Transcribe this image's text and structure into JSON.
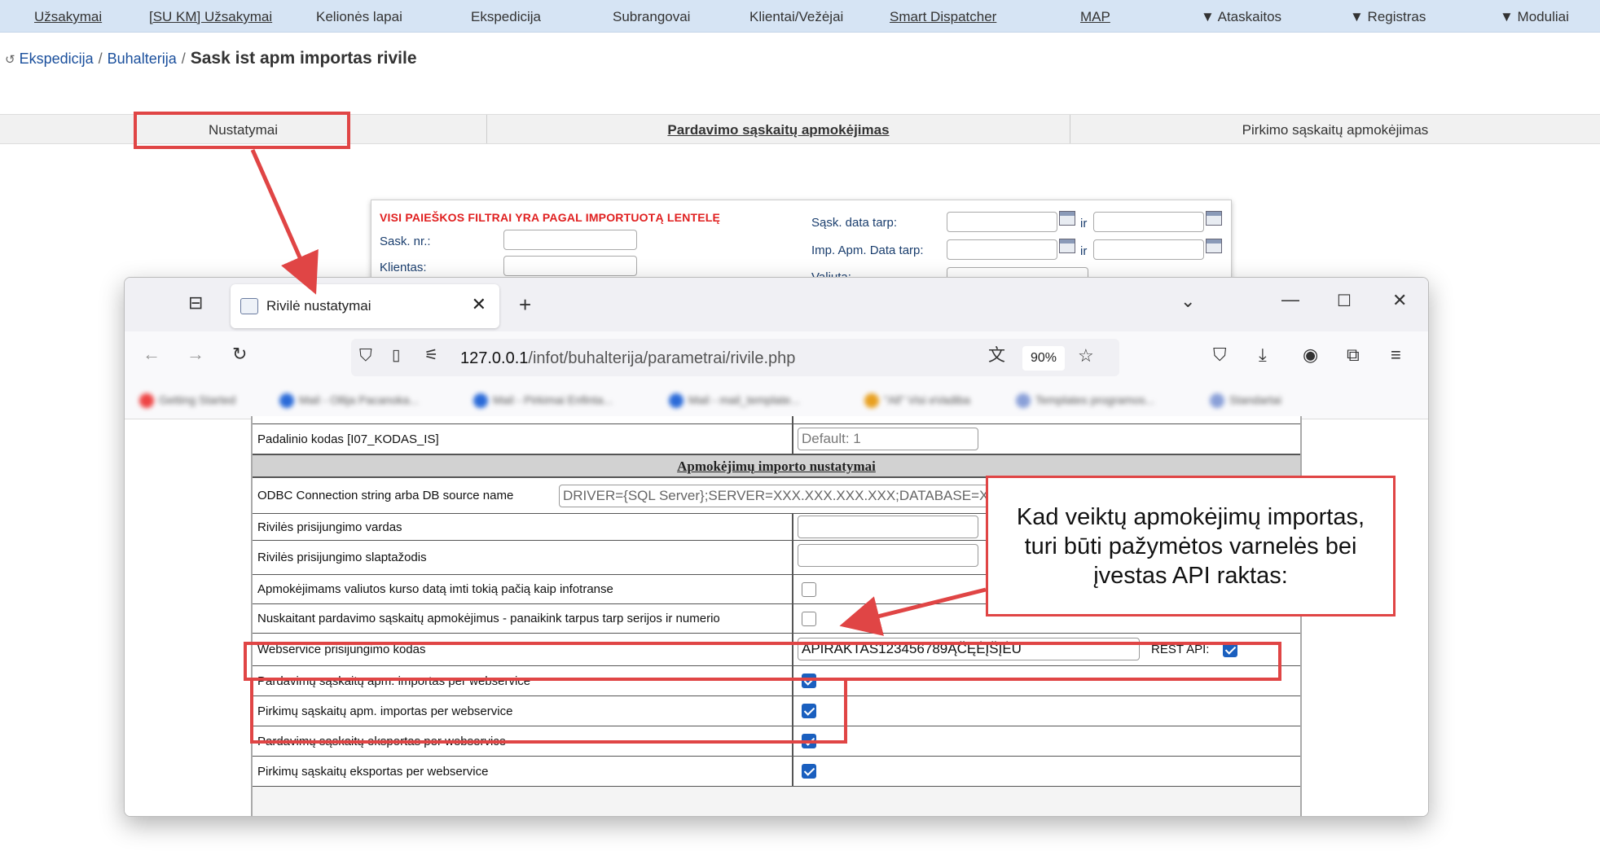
{
  "topnav": {
    "items": [
      "Užsakymai",
      "[SU KM] Užsakymai",
      "Kelionės lapai",
      "Ekspedicija",
      "Subrangovai",
      "Klientai/Vežėjai",
      "Smart Dispatcher",
      "MAP",
      "▼ Ataskaitos",
      "▼ Registras",
      "▼ Moduliai"
    ]
  },
  "breadcrumb": {
    "link1": "Ekspedicija",
    "link2": "Buhalterija",
    "sep": "/",
    "current": "Sask ist apm importas rivile"
  },
  "tabs": {
    "settings": "Nustatymai",
    "sales": "Pardavimo sąskaitų apmokėjimas",
    "purchase": "Pirkimo sąskaitų apmokėjimas"
  },
  "filter": {
    "warning": "VISI PAIEŠKOS FILTRAI YRA PAGAL IMPORTUOTĄ LENTELĘ",
    "invoice_no": "Sask. nr.:",
    "client": "Klientas:",
    "invoice_date": "Sąsk. data tarp:",
    "payment_date": "Imp. Apm. Data tarp:",
    "currency": "Valiuta:",
    "and": "ir"
  },
  "browser": {
    "tab_title": "Rivilė nustatymai",
    "url_host": "127.0.0.1",
    "url_path": "/infot/buhalterija/parametrai/rivile.php",
    "zoom": "90%",
    "bookmarks": [
      "Getting Started",
      "Mail - Ollija Pacanoka...",
      "Mail - Pirkimai Enfinta...",
      "Mail - mail_template...",
      "\"All\" Visi eVadiba",
      "Templates programos...",
      "Standartai"
    ]
  },
  "settings": {
    "division_code_label": "Padalinio kodas [I07_KODAS_IS]",
    "division_code_value": "Default: 1",
    "section_title": "Apmokėjimų importo nustatymai",
    "odbc_label": "ODBC Connection string arba DB source name",
    "odbc_value": "DRIVER={SQL Server};SERVER=XXX.XXX.XXX.XXX;DATABASE=XXX;",
    "username_label": "Rivilės prisijungimo vardas",
    "password_label": "Rivilės prisijungimo slaptažodis",
    "currency_date_label": "Apmokėjimams valiutos kurso datą imti tokią pačią kaip infotranse",
    "remove_spaces_label": "Nuskaitant pardavimo sąskaitų apmokėjimus - panaikink tarpus tarp serijos ir numerio",
    "webservice_label": "Webservice prisijungimo kodas",
    "webservice_value": "APIRAKTAS123456789ĄČĘĖĮŠĮĖŪ",
    "rest_api_label": "REST API:",
    "sales_import_label": "Pardavimų sąskaitų apm. importas per webservice",
    "purchase_import_label": "Pirkimų sąskaitų apm. importas per webservice",
    "sales_export_label": "Pardavimų sąskaitų eksportas per webservice",
    "purchase_export_label": "Pirkimų sąskaitų eksportas per webservice",
    "checkbox_states": {
      "currency_date": false,
      "remove_spaces": false,
      "rest_api": true,
      "sales_import": true,
      "purchase_import": true,
      "sales_export": true,
      "purchase_export": true
    }
  },
  "callout": {
    "line1": "Kad veiktų apmokėjimų importas,",
    "line2": "turi būti pažymėtos varnelės bei",
    "line3": "įvestas API raktas:"
  },
  "colors": {
    "highlight": "#e04545",
    "nav_bg": "#d6e4f4",
    "checkbox_on": "#1a5fbf",
    "warning": "#e02020"
  }
}
